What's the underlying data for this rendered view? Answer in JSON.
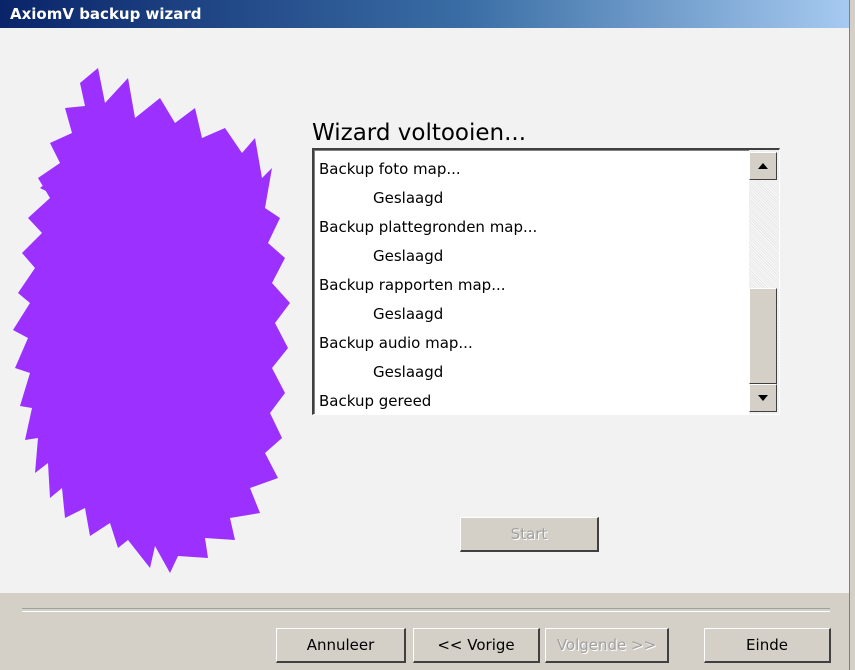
{
  "window": {
    "title": "AxiomV backup wizard"
  },
  "main": {
    "heading": "Wizard voltooien...",
    "log_items": [
      {
        "text": "Backup foto map...",
        "indent": false
      },
      {
        "text": "Geslaagd",
        "indent": true
      },
      {
        "text": "Backup plattegronden map...",
        "indent": false
      },
      {
        "text": "Geslaagd",
        "indent": true
      },
      {
        "text": "Backup rapporten map...",
        "indent": false
      },
      {
        "text": "Geslaagd",
        "indent": true
      },
      {
        "text": "Backup audio map...",
        "indent": false
      },
      {
        "text": "Geslaagd",
        "indent": true
      },
      {
        "text": "Backup gereed",
        "indent": false
      }
    ],
    "start_label": "Start"
  },
  "footer": {
    "cancel_label": "Annuleer",
    "prev_label": "<< Vorige",
    "next_label": "Volgende >>",
    "finish_label": "Einde"
  },
  "colors": {
    "accent": "#9b30ff",
    "title_start": "#0a246a",
    "title_end": "#a6caf0"
  },
  "icons": {
    "scroll_up": "arrow-up-icon",
    "scroll_down": "arrow-down-icon"
  }
}
